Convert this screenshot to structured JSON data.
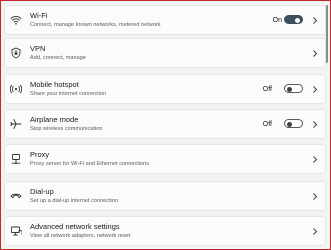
{
  "colors": {
    "frame_border": "#c4262e",
    "background": "#f3f3f3",
    "card": "#fbfbfb",
    "toggle_on": "#3d4f5c"
  },
  "rows": [
    {
      "icon": "wifi-icon",
      "title": "Wi-Fi",
      "subtitle": "Connect, manage known networks, metered network",
      "state": "On",
      "toggle": true
    },
    {
      "icon": "shield-icon",
      "title": "VPN",
      "subtitle": "Add, connect, manage"
    },
    {
      "icon": "hotspot-icon",
      "title": "Mobile hotspot",
      "subtitle": "Share your internet connection",
      "state": "Off",
      "toggle": false
    },
    {
      "icon": "airplane-icon",
      "title": "Airplane mode",
      "subtitle": "Stop wireless communication",
      "state": "Off",
      "toggle": false
    },
    {
      "icon": "globe-icon",
      "title": "Proxy",
      "subtitle": "Proxy server for Wi-Fi and Ethernet connections"
    },
    {
      "icon": "dialup-icon",
      "title": "Dial-up",
      "subtitle": "Set up a dial-up internet connection"
    },
    {
      "icon": "monitor-icon",
      "title": "Advanced network settings",
      "subtitle": "View all network adapters, network reset"
    }
  ]
}
